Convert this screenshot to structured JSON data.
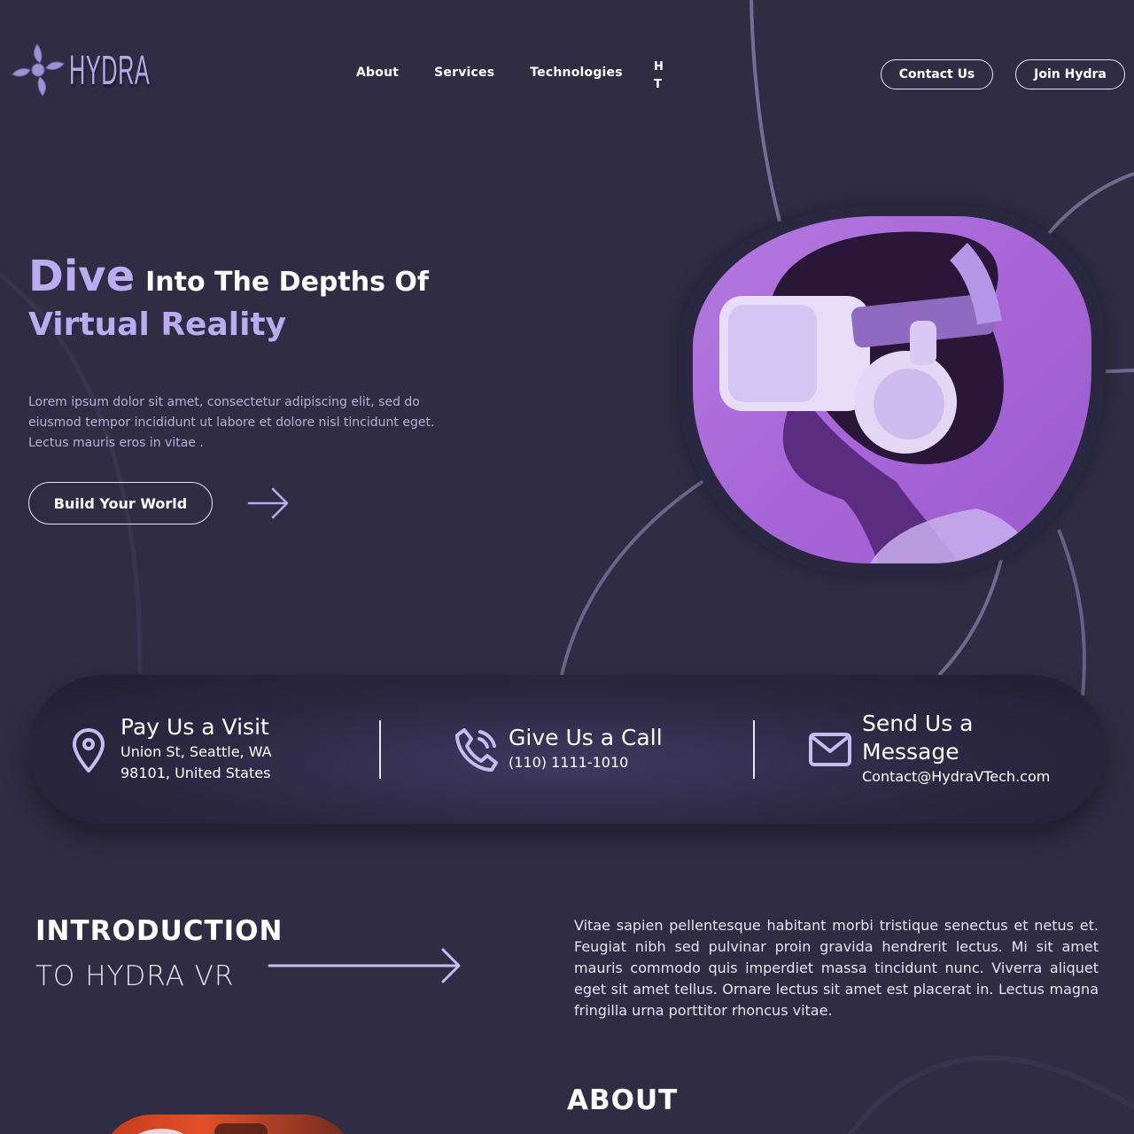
{
  "brand": {
    "name": "HYDRA"
  },
  "nav": {
    "items": [
      "About",
      "Services",
      "Technologies"
    ],
    "overflow_item": "H T"
  },
  "header_buttons": {
    "contact": "Contact Us",
    "join": "Join Hydra"
  },
  "hero": {
    "title_accent": "Dive",
    "title_rest": "Into The Depths Of",
    "title_line2": "Virtual Reality",
    "description": "Lorem ipsum dolor sit amet, consectetur adipiscing elit, sed do eiusmod tempor incididunt ut labore et dolore nisl tincidunt eget. Lectus mauris eros in vitae .",
    "cta": "Build Your World"
  },
  "contact": {
    "visit": {
      "title": "Pay Us a Visit",
      "line1": "Union St, Seattle, WA",
      "line2": "98101, United States"
    },
    "call": {
      "title": "Give Us a Call",
      "phone": "(110) 1111-1010"
    },
    "message": {
      "title_line1": "Send Us a",
      "title_line2": "Message",
      "email": "Contact@HydraVTech.com"
    }
  },
  "introduction": {
    "heading_line1": "INTRODUCTION",
    "heading_line2": "TO HYDRA VR",
    "body": "Vitae sapien pellentesque habitant morbi tristique senectus et netus et. Feugiat nibh sed pulvinar proin gravida hendrerit lectus. Mi sit amet mauris commodo quis imperdiet massa tincidunt nunc. Viverra aliquet eget sit amet tellus. Ornare lectus sit amet est placerat in. Lectus magna fringilla urna porttitor rhoncus vitae."
  },
  "about": {
    "heading": "ABOUT"
  },
  "colors": {
    "background": "#302c44",
    "accent": "#b9acf0",
    "muted_text": "#b7b0d6",
    "image_purple": "#a865d8"
  },
  "icons": [
    "hydra-logo-icon",
    "arrow-right-icon",
    "location-pin-icon",
    "phone-icon",
    "mail-icon"
  ]
}
